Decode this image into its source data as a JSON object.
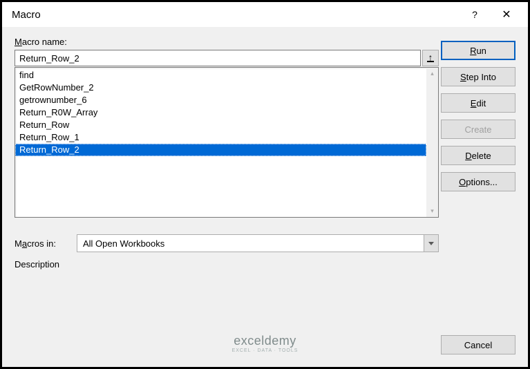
{
  "titlebar": {
    "title": "Macro",
    "help_label": "?",
    "close_label": "✕"
  },
  "labels": {
    "macro_name": "Macro name:",
    "macros_in": "Macros in:",
    "description": "Description"
  },
  "macro_name_input": "Return_Row_2",
  "macro_list": [
    "find",
    "GetRowNumber_2",
    "getrownumber_6",
    "Return_R0W_Array",
    "Return_Row",
    "Return_Row_1",
    "Return_Row_2"
  ],
  "selected_index": 6,
  "macros_in_value": "All Open Workbooks",
  "buttons": {
    "run": "Run",
    "step_into": "Step Into",
    "edit": "Edit",
    "create": "Create",
    "delete": "Delete",
    "options": "Options...",
    "cancel": "Cancel"
  },
  "watermark": {
    "main": "exceldemy",
    "sub": "EXCEL · DATA · TOOLS"
  }
}
